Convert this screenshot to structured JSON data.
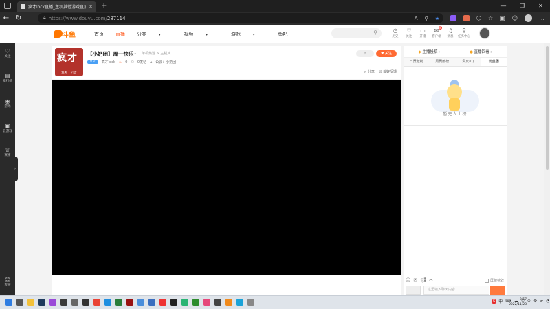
{
  "browser": {
    "tab_title": "疯才lock直播_主机其他游戏直播",
    "tab_close": "✕",
    "new_tab": "+",
    "url_host": "https://www.douyu.com/",
    "url_path": "287114",
    "window_controls": [
      "—",
      "❐",
      "✕"
    ]
  },
  "site": {
    "logo_text": "斗鱼",
    "nav": [
      "首页",
      "直播",
      "分类",
      "视频",
      "游戏",
      "鱼吧"
    ],
    "nav_active_index": 1,
    "header_icons": [
      {
        "icon": "clock-icon",
        "glyph": "◷",
        "label": "历史"
      },
      {
        "icon": "heart-icon",
        "glyph": "♡",
        "label": "关注"
      },
      {
        "icon": "play-icon",
        "glyph": "▭",
        "label": "开播"
      },
      {
        "icon": "gift-icon",
        "glyph": "✉",
        "label": "客户端",
        "badge": "8"
      },
      {
        "icon": "bell-icon",
        "glyph": "♫",
        "label": "消息"
      },
      {
        "icon": "task-icon",
        "glyph": "⚲",
        "label": "任务中心"
      }
    ]
  },
  "sidebar": {
    "items": [
      {
        "glyph": "♡",
        "label": "关注"
      },
      {
        "glyph": "▤",
        "label": "排行榜"
      },
      {
        "glyph": "◉",
        "label": "游戏"
      },
      {
        "glyph": "▣",
        "label": "云游戏"
      },
      {
        "glyph": "♕",
        "label": "赛事"
      },
      {
        "glyph": "☺",
        "label": "客服"
      }
    ],
    "toggle": "›"
  },
  "room": {
    "avatar_text": "疯才",
    "avatar_sub": "鱼吧 | 公告",
    "title": "【小奶团】周一快乐~",
    "category": "单机热游 > 主机其...",
    "level": "LV.31",
    "streamer": "疯才lock",
    "hot": "0",
    "fans": "0发帖",
    "notice": "公会：小奶团",
    "follow_label": "关注",
    "ghost_label": "",
    "share_label": "分享",
    "report_label": "偏好反馈"
  },
  "right_panel": {
    "top_tabs": [
      "主播投稿",
      "直播回看"
    ],
    "tabs": [
      "日贡献榜",
      "周贡献榜",
      "贵宾(0)",
      "粉丝团"
    ],
    "active_tab_index": 3,
    "mascot_caption": "暂无人上榜",
    "block_gift_label": "屏蔽特效",
    "chat_placeholder": "这里输入聊天内容"
  },
  "taskbar": {
    "time": "9:57",
    "date": "2022/11/28",
    "tray_sg": "S",
    "tray_icons": [
      "中",
      "⌨",
      "☁",
      "✆",
      "⊙",
      "⚙",
      "▰",
      "◔",
      "🔊"
    ]
  },
  "colors": {
    "accent": "#ff5d23",
    "follow": "#ff6a33",
    "brand_red": "#b3322b"
  }
}
